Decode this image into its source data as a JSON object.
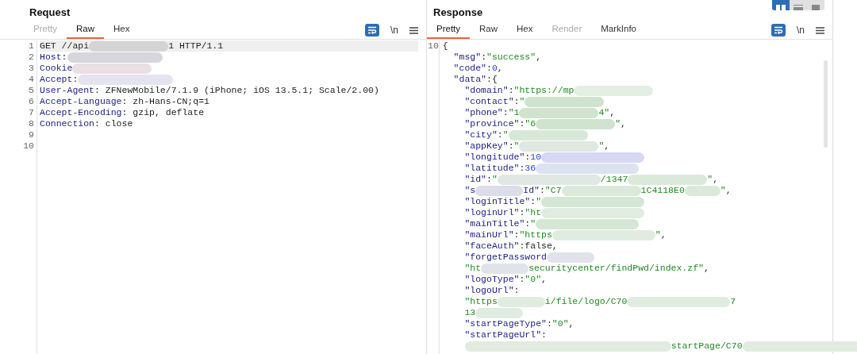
{
  "request": {
    "title": "Request",
    "tabs": [
      {
        "label": "Pretty",
        "selected": false,
        "disabled": true
      },
      {
        "label": "Raw",
        "selected": true,
        "disabled": false
      },
      {
        "label": "Hex",
        "selected": false,
        "disabled": false
      }
    ],
    "toolbar": {
      "wrap_on": true,
      "newline_label": "\\n"
    },
    "lines": [
      {
        "number": "1",
        "highlighted": true,
        "parts": [
          {
            "kind": "plain",
            "text": "GET //api"
          },
          {
            "kind": "redacted",
            "color": "#d4d4d4"
          },
          {
            "kind": "plain",
            "text": "1 HTTP/1.1"
          }
        ]
      },
      {
        "number": "2",
        "highlighted": false,
        "parts": [
          {
            "kind": "key",
            "text": "Host"
          },
          {
            "kind": "plain",
            "text": ":"
          },
          {
            "kind": "redacted",
            "color": "#d6d6dc"
          }
        ]
      },
      {
        "number": "3",
        "highlighted": false,
        "parts": [
          {
            "kind": "key",
            "text": "Cookie"
          },
          {
            "kind": "redacted",
            "color": "#eadfe4"
          }
        ]
      },
      {
        "number": "4",
        "highlighted": false,
        "parts": [
          {
            "kind": "key",
            "text": "Accept"
          },
          {
            "kind": "plain",
            "text": ":"
          },
          {
            "kind": "redacted",
            "color": "#e4e4f0"
          }
        ]
      },
      {
        "number": "5",
        "highlighted": false,
        "parts": [
          {
            "kind": "key",
            "text": "User-Agent"
          },
          {
            "kind": "plain",
            "text": ": ZFNewMobile/7.1.9 (iPhone; iOS 13.5.1; Scale/2.00)"
          }
        ]
      },
      {
        "number": "6",
        "highlighted": false,
        "parts": [
          {
            "kind": "key",
            "text": "Accept-Language"
          },
          {
            "kind": "plain",
            "text": ": zh-Hans-CN;q=1"
          }
        ]
      },
      {
        "number": "7",
        "highlighted": false,
        "parts": [
          {
            "kind": "key",
            "text": "Accept-Encoding"
          },
          {
            "kind": "plain",
            "text": ": gzip, deflate"
          }
        ]
      },
      {
        "number": "8",
        "highlighted": false,
        "parts": [
          {
            "kind": "key",
            "text": "Connection"
          },
          {
            "kind": "plain",
            "text": ": close"
          }
        ]
      },
      {
        "number": "9",
        "highlighted": false
      },
      {
        "number": "10",
        "highlighted": false
      }
    ]
  },
  "response": {
    "title": "Response",
    "layout_buttons": [
      {
        "kind": "split",
        "selected": true
      },
      {
        "kind": "stacked",
        "selected": false
      },
      {
        "kind": "single",
        "selected": false
      }
    ],
    "tabs": [
      {
        "label": "Pretty",
        "selected": true,
        "disabled": false
      },
      {
        "label": "Raw",
        "selected": false,
        "disabled": false
      },
      {
        "label": "Hex",
        "selected": false,
        "disabled": false
      },
      {
        "label": "Render",
        "selected": false,
        "disabled": true
      },
      {
        "label": "MarkInfo",
        "selected": false,
        "disabled": false
      }
    ],
    "toolbar": {
      "wrap_on": true,
      "newline_label": "\\n"
    },
    "lines": [
      {
        "number": "10",
        "parts": [
          {
            "kind": "plain",
            "text": "{"
          }
        ]
      },
      {
        "parts": [
          {
            "kind": "key",
            "text": "  \"msg\""
          },
          {
            "kind": "plain",
            "text": ":"
          },
          {
            "kind": "string",
            "text": "\"success\""
          },
          {
            "kind": "plain",
            "text": ","
          }
        ]
      },
      {
        "parts": [
          {
            "kind": "key",
            "text": "  \"code\""
          },
          {
            "kind": "plain",
            "text": ":"
          },
          {
            "kind": "number",
            "text": "0"
          },
          {
            "kind": "plain",
            "text": ","
          }
        ]
      },
      {
        "parts": [
          {
            "kind": "key",
            "text": "  \"data\""
          },
          {
            "kind": "plain",
            "text": ":{"
          }
        ]
      },
      {
        "parts": [
          {
            "kind": "key",
            "text": "    \"domain\""
          },
          {
            "kind": "plain",
            "text": ":"
          },
          {
            "kind": "string",
            "text": "\"https://mp"
          },
          {
            "kind": "redacted",
            "color": "#e4efe4"
          }
        ]
      },
      {
        "parts": [
          {
            "kind": "key",
            "text": "    \"contact\""
          },
          {
            "kind": "plain",
            "text": ":"
          },
          {
            "kind": "string",
            "text": "\""
          },
          {
            "kind": "redacted",
            "color": "#cfe3cf"
          }
        ]
      },
      {
        "parts": [
          {
            "kind": "key",
            "text": "    \"phone\""
          },
          {
            "kind": "plain",
            "text": ":"
          },
          {
            "kind": "string",
            "text": "\"1"
          },
          {
            "kind": "redacted",
            "color": "#cfe3cf"
          },
          {
            "kind": "string",
            "text": "4\""
          },
          {
            "kind": "plain",
            "text": ","
          }
        ]
      },
      {
        "parts": [
          {
            "kind": "key",
            "text": "    \"province\""
          },
          {
            "kind": "plain",
            "text": ":"
          },
          {
            "kind": "string",
            "text": "\"6"
          },
          {
            "kind": "redacted",
            "color": "#cfe3cf"
          },
          {
            "kind": "string",
            "text": "\""
          },
          {
            "kind": "plain",
            "text": ","
          }
        ]
      },
      {
        "parts": [
          {
            "kind": "key",
            "text": "    \"city\""
          },
          {
            "kind": "plain",
            "text": ":"
          },
          {
            "kind": "string",
            "text": "\""
          },
          {
            "kind": "redacted",
            "color": "#d8e8d8"
          }
        ]
      },
      {
        "parts": [
          {
            "kind": "key",
            "text": "    \"appKey\""
          },
          {
            "kind": "plain",
            "text": ":"
          },
          {
            "kind": "string",
            "text": "\""
          },
          {
            "kind": "redacted",
            "color": "#dde8e0"
          },
          {
            "kind": "string",
            "text": "\""
          },
          {
            "kind": "plain",
            "text": ","
          }
        ]
      },
      {
        "parts": [
          {
            "kind": "key",
            "text": "    \"longitude\""
          },
          {
            "kind": "plain",
            "text": ":"
          },
          {
            "kind": "number",
            "text": "10"
          },
          {
            "kind": "redacted",
            "color": "#d6d8f4"
          }
        ]
      },
      {
        "parts": [
          {
            "kind": "key",
            "text": "    \"latitude\""
          },
          {
            "kind": "plain",
            "text": ":"
          },
          {
            "kind": "number",
            "text": "36"
          },
          {
            "kind": "redacted",
            "color": "#dde2f0"
          }
        ]
      },
      {
        "parts": [
          {
            "kind": "key",
            "text": "    \"id\""
          },
          {
            "kind": "plain",
            "text": ":"
          },
          {
            "kind": "string",
            "text": "\""
          },
          {
            "kind": "redacted",
            "color": "#dfe8e2"
          },
          {
            "kind": "string",
            "text": "/1347"
          },
          {
            "kind": "redacted",
            "color": "#dbe9db"
          },
          {
            "kind": "string",
            "text": "\""
          },
          {
            "kind": "plain",
            "text": ","
          }
        ]
      },
      {
        "parts": [
          {
            "kind": "key",
            "text": "    \"s"
          },
          {
            "kind": "redacted",
            "color": "#dcdcea"
          },
          {
            "kind": "key",
            "text": "Id\""
          },
          {
            "kind": "plain",
            "text": ":"
          },
          {
            "kind": "string",
            "text": "\"C7"
          },
          {
            "kind": "redacted",
            "color": "#dbe9db"
          },
          {
            "kind": "string",
            "text": "1C4118E0"
          },
          {
            "kind": "redacted",
            "color": "#dbe9db"
          },
          {
            "kind": "string",
            "text": "\""
          },
          {
            "kind": "plain",
            "text": ","
          }
        ]
      },
      {
        "parts": [
          {
            "kind": "key",
            "text": "    \"loginTitle\""
          },
          {
            "kind": "plain",
            "text": ":"
          },
          {
            "kind": "string",
            "text": "\""
          },
          {
            "kind": "redacted",
            "color": "#d4e6d4"
          }
        ]
      },
      {
        "parts": [
          {
            "kind": "key",
            "text": "    \"loginUrl\""
          },
          {
            "kind": "plain",
            "text": ":"
          },
          {
            "kind": "string",
            "text": "\"ht"
          },
          {
            "kind": "redacted",
            "color": "#e0ece0"
          }
        ]
      },
      {
        "parts": [
          {
            "kind": "key",
            "text": "    \"mainTitle\""
          },
          {
            "kind": "plain",
            "text": ":"
          },
          {
            "kind": "string",
            "text": "\""
          },
          {
            "kind": "redacted",
            "color": "#d4e6d4"
          }
        ]
      },
      {
        "parts": [
          {
            "kind": "key",
            "text": "    \"mainUrl\""
          },
          {
            "kind": "plain",
            "text": ":"
          },
          {
            "kind": "string",
            "text": "\"https"
          },
          {
            "kind": "redacted",
            "color": "#e0ece0"
          },
          {
            "kind": "string",
            "text": "\""
          },
          {
            "kind": "plain",
            "text": ","
          }
        ]
      },
      {
        "parts": [
          {
            "kind": "key",
            "text": "    \"faceAuth\""
          },
          {
            "kind": "plain",
            "text": ":false,"
          }
        ]
      },
      {
        "parts": [
          {
            "kind": "key",
            "text": "    \"forgetPassword"
          },
          {
            "kind": "redacted",
            "color": "#e0e4ea"
          }
        ]
      },
      {
        "parts": [
          {
            "kind": "string",
            "text": "    \"ht"
          },
          {
            "kind": "redacted",
            "color": "#e0e4ea"
          },
          {
            "kind": "string",
            "text": "securitycenter/findPwd/index.zf\""
          },
          {
            "kind": "plain",
            "text": ","
          }
        ]
      },
      {
        "parts": [
          {
            "kind": "key",
            "text": "    \"logoType\""
          },
          {
            "kind": "plain",
            "text": ":"
          },
          {
            "kind": "string",
            "text": "\"0\""
          },
          {
            "kind": "plain",
            "text": ","
          }
        ]
      },
      {
        "parts": [
          {
            "kind": "key",
            "text": "    \"logoUrl\""
          },
          {
            "kind": "plain",
            "text": ":"
          }
        ]
      },
      {
        "parts": [
          {
            "kind": "string",
            "text": "    \"https"
          },
          {
            "kind": "redacted",
            "color": "#e0ece0"
          },
          {
            "kind": "string",
            "text": "i/file/logo/C70"
          },
          {
            "kind": "redacted",
            "color": "#e0ece0"
          },
          {
            "kind": "string",
            "text": "7"
          }
        ]
      },
      {
        "parts": [
          {
            "kind": "string",
            "text": "    13"
          },
          {
            "kind": "redacted",
            "color": "#e0ece0"
          }
        ]
      },
      {
        "parts": [
          {
            "kind": "key",
            "text": "    \"startPageType\""
          },
          {
            "kind": "plain",
            "text": ":"
          },
          {
            "kind": "string",
            "text": "\"0\""
          },
          {
            "kind": "plain",
            "text": ","
          }
        ]
      },
      {
        "parts": [
          {
            "kind": "key",
            "text": "    \"startPageUrl\""
          },
          {
            "kind": "plain",
            "text": ":"
          }
        ]
      },
      {
        "parts": [
          {
            "kind": "redacted",
            "color": "#e0ece0"
          },
          {
            "kind": "string",
            "text": "startPage/C70"
          },
          {
            "kind": "redacted",
            "color": "#e0ece0"
          }
        ]
      }
    ]
  }
}
